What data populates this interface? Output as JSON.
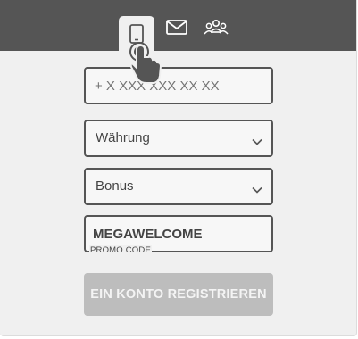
{
  "tabs": [
    {
      "name": "phone",
      "icon": "phone-icon",
      "active": true
    },
    {
      "name": "email",
      "icon": "mail-icon",
      "active": false
    },
    {
      "name": "social",
      "icon": "group-icon",
      "active": false
    }
  ],
  "form": {
    "phone_placeholder": "+ X XXX XXX XX XX",
    "currency_label": "Währung",
    "bonus_label": "Bonus",
    "promo_value": "MEGAWELCOME",
    "promo_label": "PROMO CODE",
    "submit_label": "EIN KONTO REGISTRIEREN"
  },
  "colors": {
    "header": "#555555",
    "background": "#f0f0f0",
    "border": "#555555",
    "button_disabled": "#bdbdbd"
  }
}
